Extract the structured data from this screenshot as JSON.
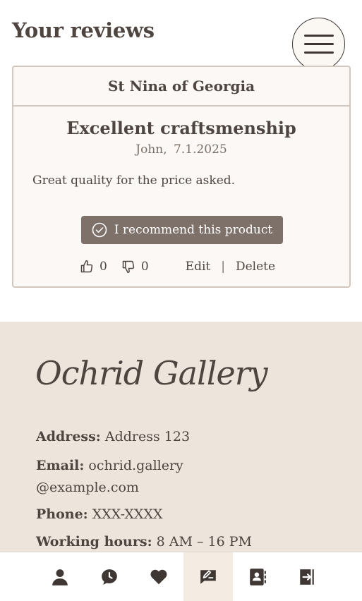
{
  "page": {
    "title": "Your reviews"
  },
  "review": {
    "product": "St Nina of Georgia",
    "title": "Excellent craftsmenship",
    "author": "John,",
    "date": "7.1.2025",
    "body": "Great quality for the price asked.",
    "recommend_label": "I recommend this product",
    "likes": "0",
    "dislikes": "0",
    "edit_label": "Edit",
    "divider": "|",
    "delete_label": "Delete"
  },
  "footer": {
    "brand": "Ochrid Gallery",
    "address_label": "Address:",
    "address_value": "Address 123",
    "email_label": "Email:",
    "email_value_1": "ochrid.gallery",
    "email_value_2": "@example.com",
    "phone_label": "Phone:",
    "phone_value": "XXX-XXXX",
    "hours_label": "Working hours:",
    "hours_value": "8 AM – 16 PM"
  },
  "nav": {
    "items": [
      {
        "icon": "user-icon"
      },
      {
        "icon": "history-icon"
      },
      {
        "icon": "heart-icon"
      },
      {
        "icon": "reviews-icon",
        "active": true
      },
      {
        "icon": "contacts-icon"
      },
      {
        "icon": "logout-icon"
      }
    ]
  },
  "colors": {
    "accent": "#7d7169",
    "text": "#4f4540",
    "footer_bg": "#ede4dc",
    "card_bg": "#fcf8f5"
  }
}
